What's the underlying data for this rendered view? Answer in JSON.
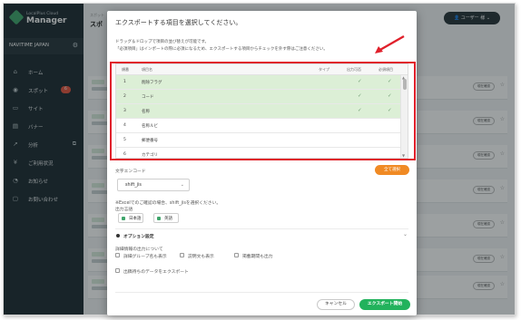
{
  "brand": {
    "sub": "LocalPlus Cloud",
    "name": "Manager"
  },
  "org": {
    "name": "NAVITIME JAPAN"
  },
  "sidebar": {
    "items": [
      {
        "label": "ホーム",
        "icon": "home-icon",
        "glyph": "⌂"
      },
      {
        "label": "スポット",
        "icon": "pin-icon",
        "glyph": "◉",
        "badge": "6"
      },
      {
        "label": "サイト",
        "icon": "site-icon",
        "glyph": "▭"
      },
      {
        "label": "バナー",
        "icon": "banner-icon",
        "glyph": "▤"
      },
      {
        "label": "分析",
        "icon": "analytics-icon",
        "glyph": "↗",
        "ext": "⧉"
      },
      {
        "label": "ご利用状況",
        "icon": "yen-icon",
        "glyph": "¥"
      },
      {
        "label": "お知らせ",
        "icon": "bell-icon",
        "glyph": "🔔"
      },
      {
        "label": "お問い合わせ",
        "icon": "mail-icon",
        "glyph": "▢"
      }
    ]
  },
  "main": {
    "title": "スポ",
    "crumb": "スポット",
    "user_label": "👤  ユーザー 様 ⌄",
    "row_button": "現在確認"
  },
  "dialog": {
    "title": "エクスポートする項目を選択してください。",
    "hint1": "ドラッグ＆ドロップで項目の並び替えが可能です。",
    "hint2": "「必須項目」はインポートの際に必須になるため、エクスポートする項目からチェックを外す際はご注意ください。",
    "columns": {
      "no": "順番",
      "name": "項目名",
      "type": "タイプ",
      "output": "出力可否",
      "required": "必須項目"
    },
    "rows": [
      {
        "no": "1",
        "name": "削除フラグ",
        "type": "",
        "output": "✓",
        "required": "✓",
        "selected": true
      },
      {
        "no": "2",
        "name": "コード",
        "type": "",
        "output": "✓",
        "required": "✓",
        "selected": true
      },
      {
        "no": "3",
        "name": "名称",
        "type": "",
        "output": "✓",
        "required": "✓",
        "selected": true
      },
      {
        "no": "4",
        "name": "名称ルビ",
        "type": "",
        "output": "",
        "required": "",
        "selected": false
      },
      {
        "no": "5",
        "name": "郵便番号",
        "type": "",
        "output": "",
        "required": "",
        "selected": false
      },
      {
        "no": "6",
        "name": "カテゴリ",
        "type": "",
        "output": "",
        "required": "",
        "selected": false
      },
      {
        "no": "7",
        "name": "住所",
        "type": "",
        "output": "",
        "required": "",
        "selected": true
      }
    ],
    "select_all": "全て選択",
    "encoding_label": "文字エンコード",
    "encoding_value": "shift_jis",
    "encoding_note": "※Excelでのご確認の場合、shift_jisを選択ください。",
    "language_label": "出力言語",
    "languages": [
      "日本語",
      "英語"
    ],
    "option_label": "オプション設定",
    "detail_label": "詳細情報の出力について",
    "detail_options": [
      "詳細グループ名も表示",
      "説明文も表示",
      "掲載期間も出力"
    ],
    "extra_option": "出稿待ちのデータをエクスポート",
    "cancel": "キャンセル",
    "export": "エクスポート開始"
  },
  "colors": {
    "accent_green": "#22b25c",
    "selected_row": "#dcefd6",
    "highlight": "#e0202b",
    "orange": "#f08a24",
    "sidebar": "#1d2a31"
  }
}
